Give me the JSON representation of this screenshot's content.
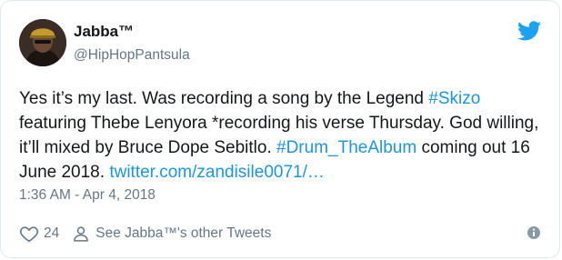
{
  "user": {
    "display_name": "Jabba™",
    "handle": "@HipHopPantsula"
  },
  "tweet": {
    "segments": [
      {
        "text": "Yes it’s my last. Was recording a song by the Legend ",
        "type": "text"
      },
      {
        "text": "#Skizo",
        "type": "hashtag"
      },
      {
        "text": " featuring Thebe Lenyora *recording his verse Thursday. God willing, it’ll mixed by Bruce Dope Sebitlo. ",
        "type": "text"
      },
      {
        "text": "#Drum_TheAlbum",
        "type": "hashtag"
      },
      {
        "text": " coming out 16 June 2018. ",
        "type": "text"
      },
      {
        "text": "twitter.com/zandisile0071/…",
        "type": "link"
      }
    ],
    "timestamp": "1:36 AM - Apr 4, 2018"
  },
  "actions": {
    "like_count": "24",
    "other_tweets_label": "See Jabba™'s other Tweets"
  },
  "icons": {
    "brand": "twitter-bird-icon",
    "like": "heart-icon",
    "profile": "person-icon",
    "info": "info-icon"
  },
  "colors": {
    "brand_blue": "#1da1f2",
    "link_blue": "#1b95e0",
    "text": "#14171a",
    "muted": "#657786",
    "border": "#e1e8ed"
  }
}
